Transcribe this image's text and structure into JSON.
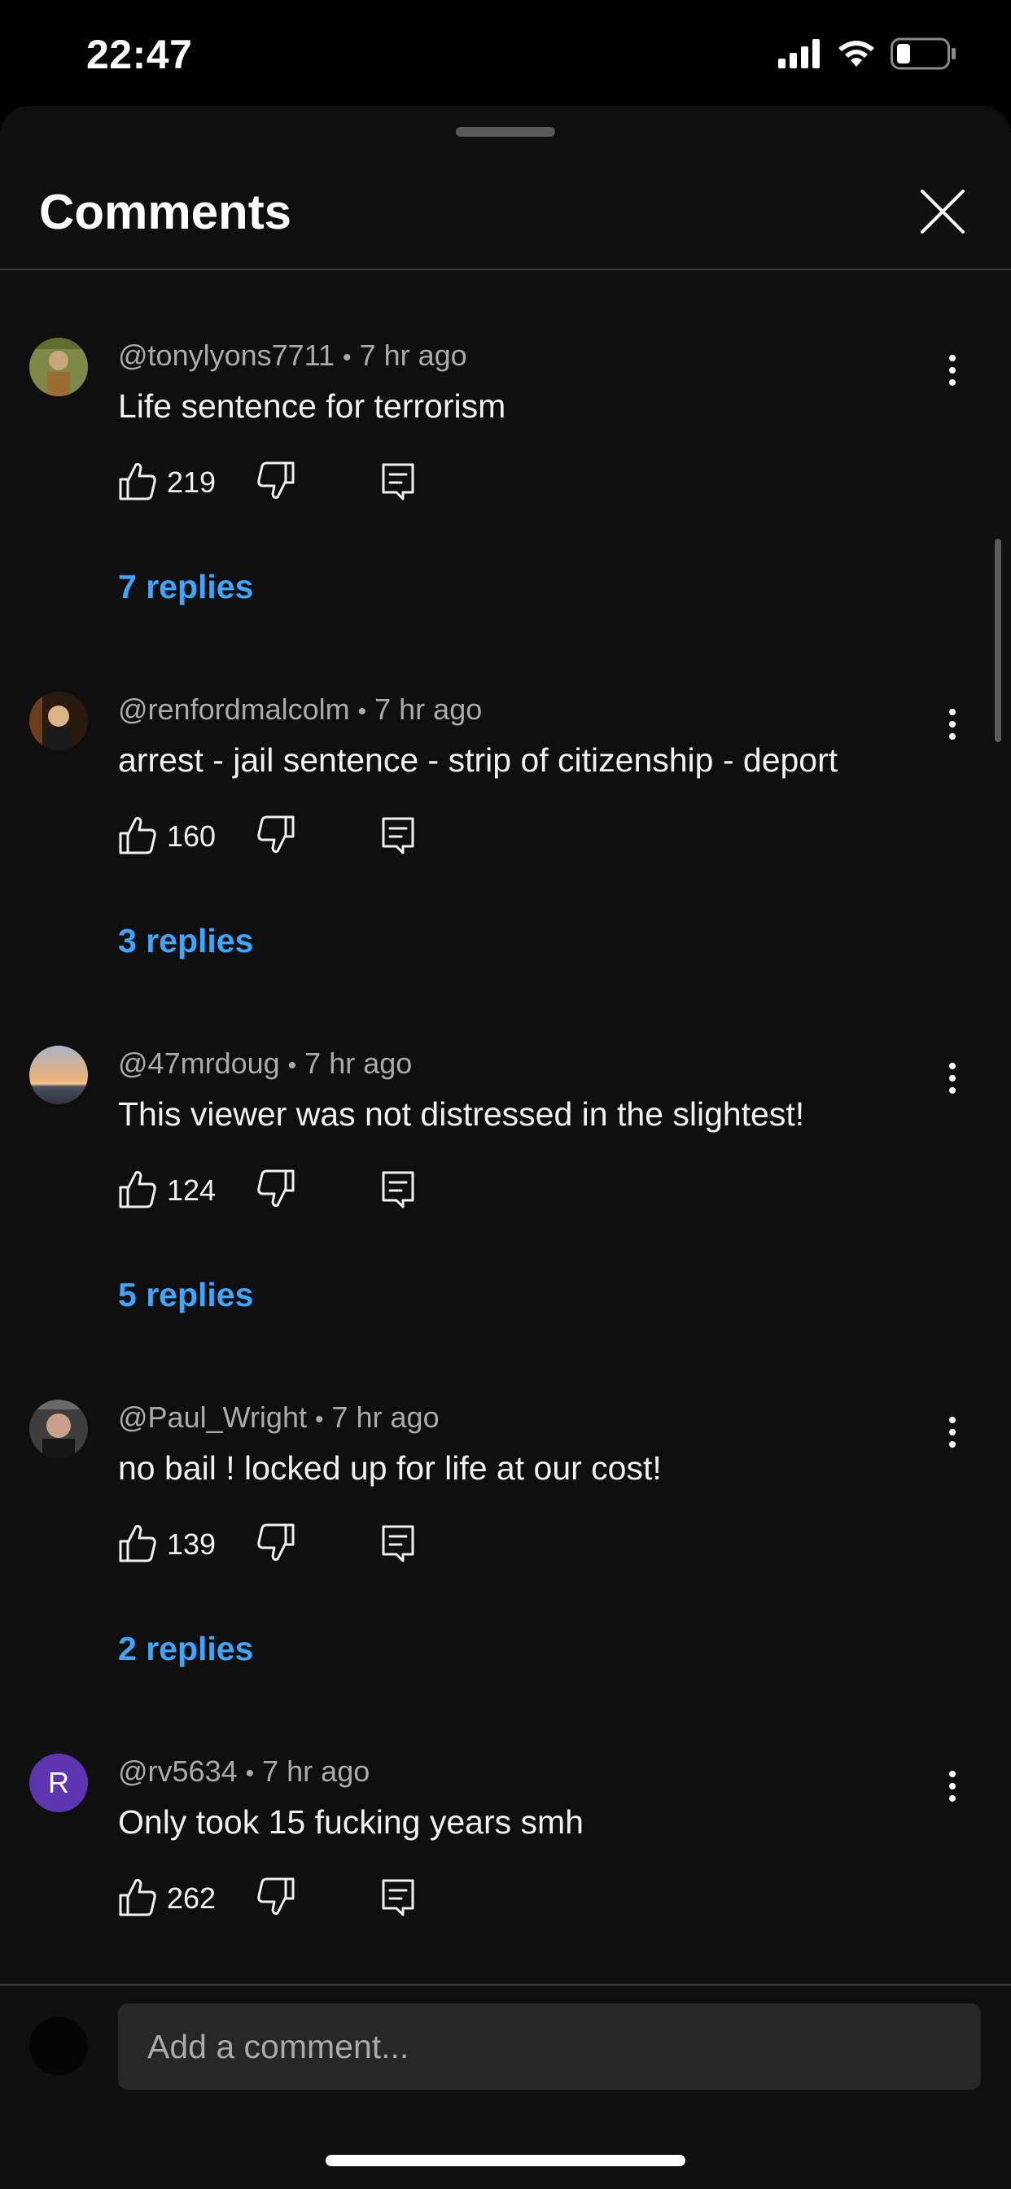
{
  "status_bar": {
    "time": "22:47",
    "icons": [
      "cellular-signal-icon",
      "wifi-icon",
      "battery-icon"
    ]
  },
  "sheet": {
    "title": "Comments",
    "close_icon": "close-icon"
  },
  "comments": [
    {
      "author": "@tonylyons7711",
      "time": "7 hr ago",
      "text": "Life sentence for terrorism",
      "likes": "219",
      "replies": "7 replies",
      "avatar_color": "#6b7a3a"
    },
    {
      "author": "@renfordmalcolm",
      "time": "7 hr ago",
      "text": "arrest - jail sentence - strip of citizenship - deport",
      "likes": "160",
      "replies": "3 replies",
      "avatar_color": "#5a3a1e"
    },
    {
      "author": "@47mrdoug",
      "time": "7 hr ago",
      "text": "This viewer was not distressed in the slightest!",
      "likes": "124",
      "replies": "5 replies",
      "avatar_color": "#c9a27e"
    },
    {
      "author": "@Paul_Wright",
      "time": "7 hr ago",
      "text": "no bail ! locked up for life at our cost!",
      "likes": "139",
      "replies": "2 replies",
      "avatar_color": "#3b3b3b"
    },
    {
      "author": "@rv5634",
      "time": "7 hr ago",
      "text": "Only took 15 fucking years smh",
      "likes": "262",
      "replies": "",
      "avatar_letter": "R",
      "avatar_color": "#5e35b1"
    }
  ],
  "composer": {
    "placeholder": "Add a comment..."
  },
  "colors": {
    "background": "#0f0f0f",
    "link": "#3ea6ff",
    "secondary_text": "#aaaaaa"
  }
}
